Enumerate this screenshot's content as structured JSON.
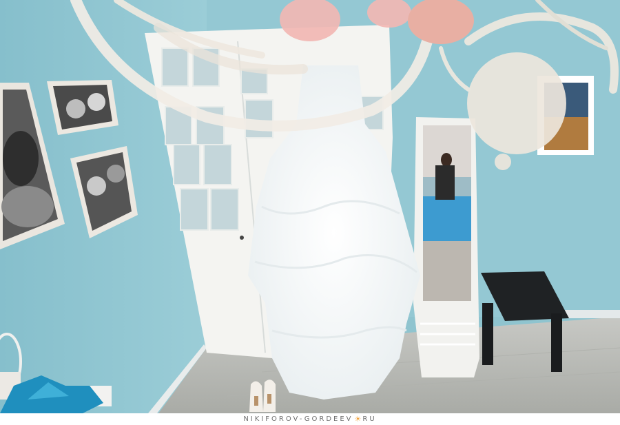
{
  "watermark": {
    "part1": "NIKIFOROV-GORDEEV",
    "part2": "RU",
    "separator_icon": "sun-icon",
    "accent_color": "#f2a23a"
  },
  "scene": {
    "wall_color": "#8fc4cf",
    "floor_color": "#b9bbb6",
    "door_color": "#f4f4f1",
    "dress_color": "#ffffff",
    "bed_color": "#3d9bd0"
  }
}
